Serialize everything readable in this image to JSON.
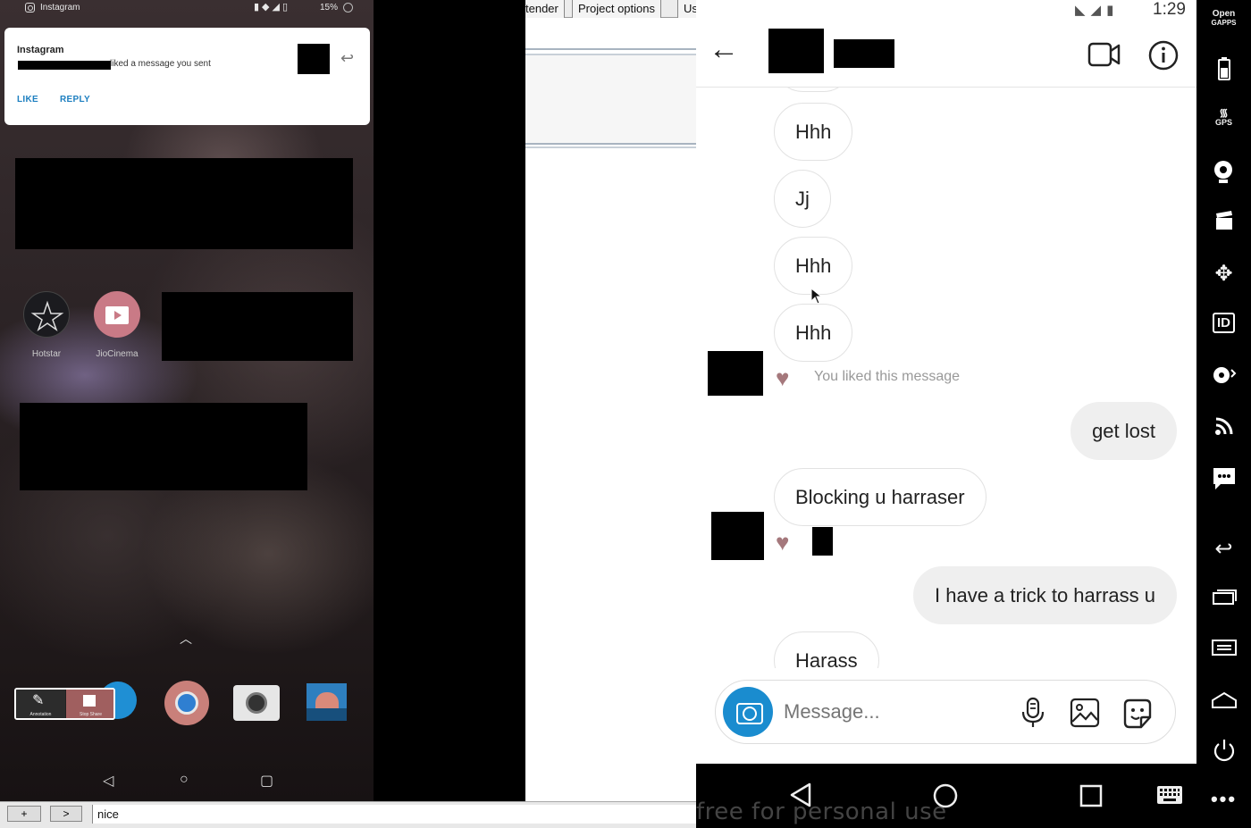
{
  "left_phone": {
    "status": {
      "app_name": "Instagram",
      "battery": "15%"
    },
    "notification": {
      "title": "Instagram",
      "text": "liked a message you sent",
      "actions": {
        "like": "LIKE",
        "reply": "REPLY"
      }
    },
    "apps": [
      {
        "label": "Hotstar"
      },
      {
        "label": "JioCinema"
      }
    ],
    "annotation_bar": {
      "annotation": "Annotation",
      "stop_share": "Stop Share"
    }
  },
  "middle": {
    "menu": [
      "tender",
      "Project options",
      "Us"
    ]
  },
  "bottom_strip": {
    "plus": "+",
    "next": ">",
    "field_value": "nice"
  },
  "watermark": "free for personal use",
  "right_phone": {
    "status": {
      "time": "1:29"
    },
    "messages": [
      {
        "text": "Hhh",
        "from": "them"
      },
      {
        "text": "Jj",
        "from": "them"
      },
      {
        "text": "Hhh",
        "from": "them"
      },
      {
        "text": "Hhh",
        "from": "them"
      },
      {
        "text": "get lost",
        "from": "me"
      },
      {
        "text": "Blocking u harraser",
        "from": "them"
      },
      {
        "text": "I have a trick to harrass u",
        "from": "me"
      },
      {
        "text": "Harass",
        "from": "them"
      }
    ],
    "liked_label": "You liked this message",
    "composer": {
      "placeholder": "Message..."
    }
  },
  "side_bar": {
    "open_gapps": [
      "Open",
      "GAPPS"
    ],
    "gps": "GPS",
    "id": "ID"
  },
  "colors": {
    "instagram_blue": "#1a8ccf",
    "heart": "#a5787c",
    "link_blue": "#1d7fc0"
  }
}
